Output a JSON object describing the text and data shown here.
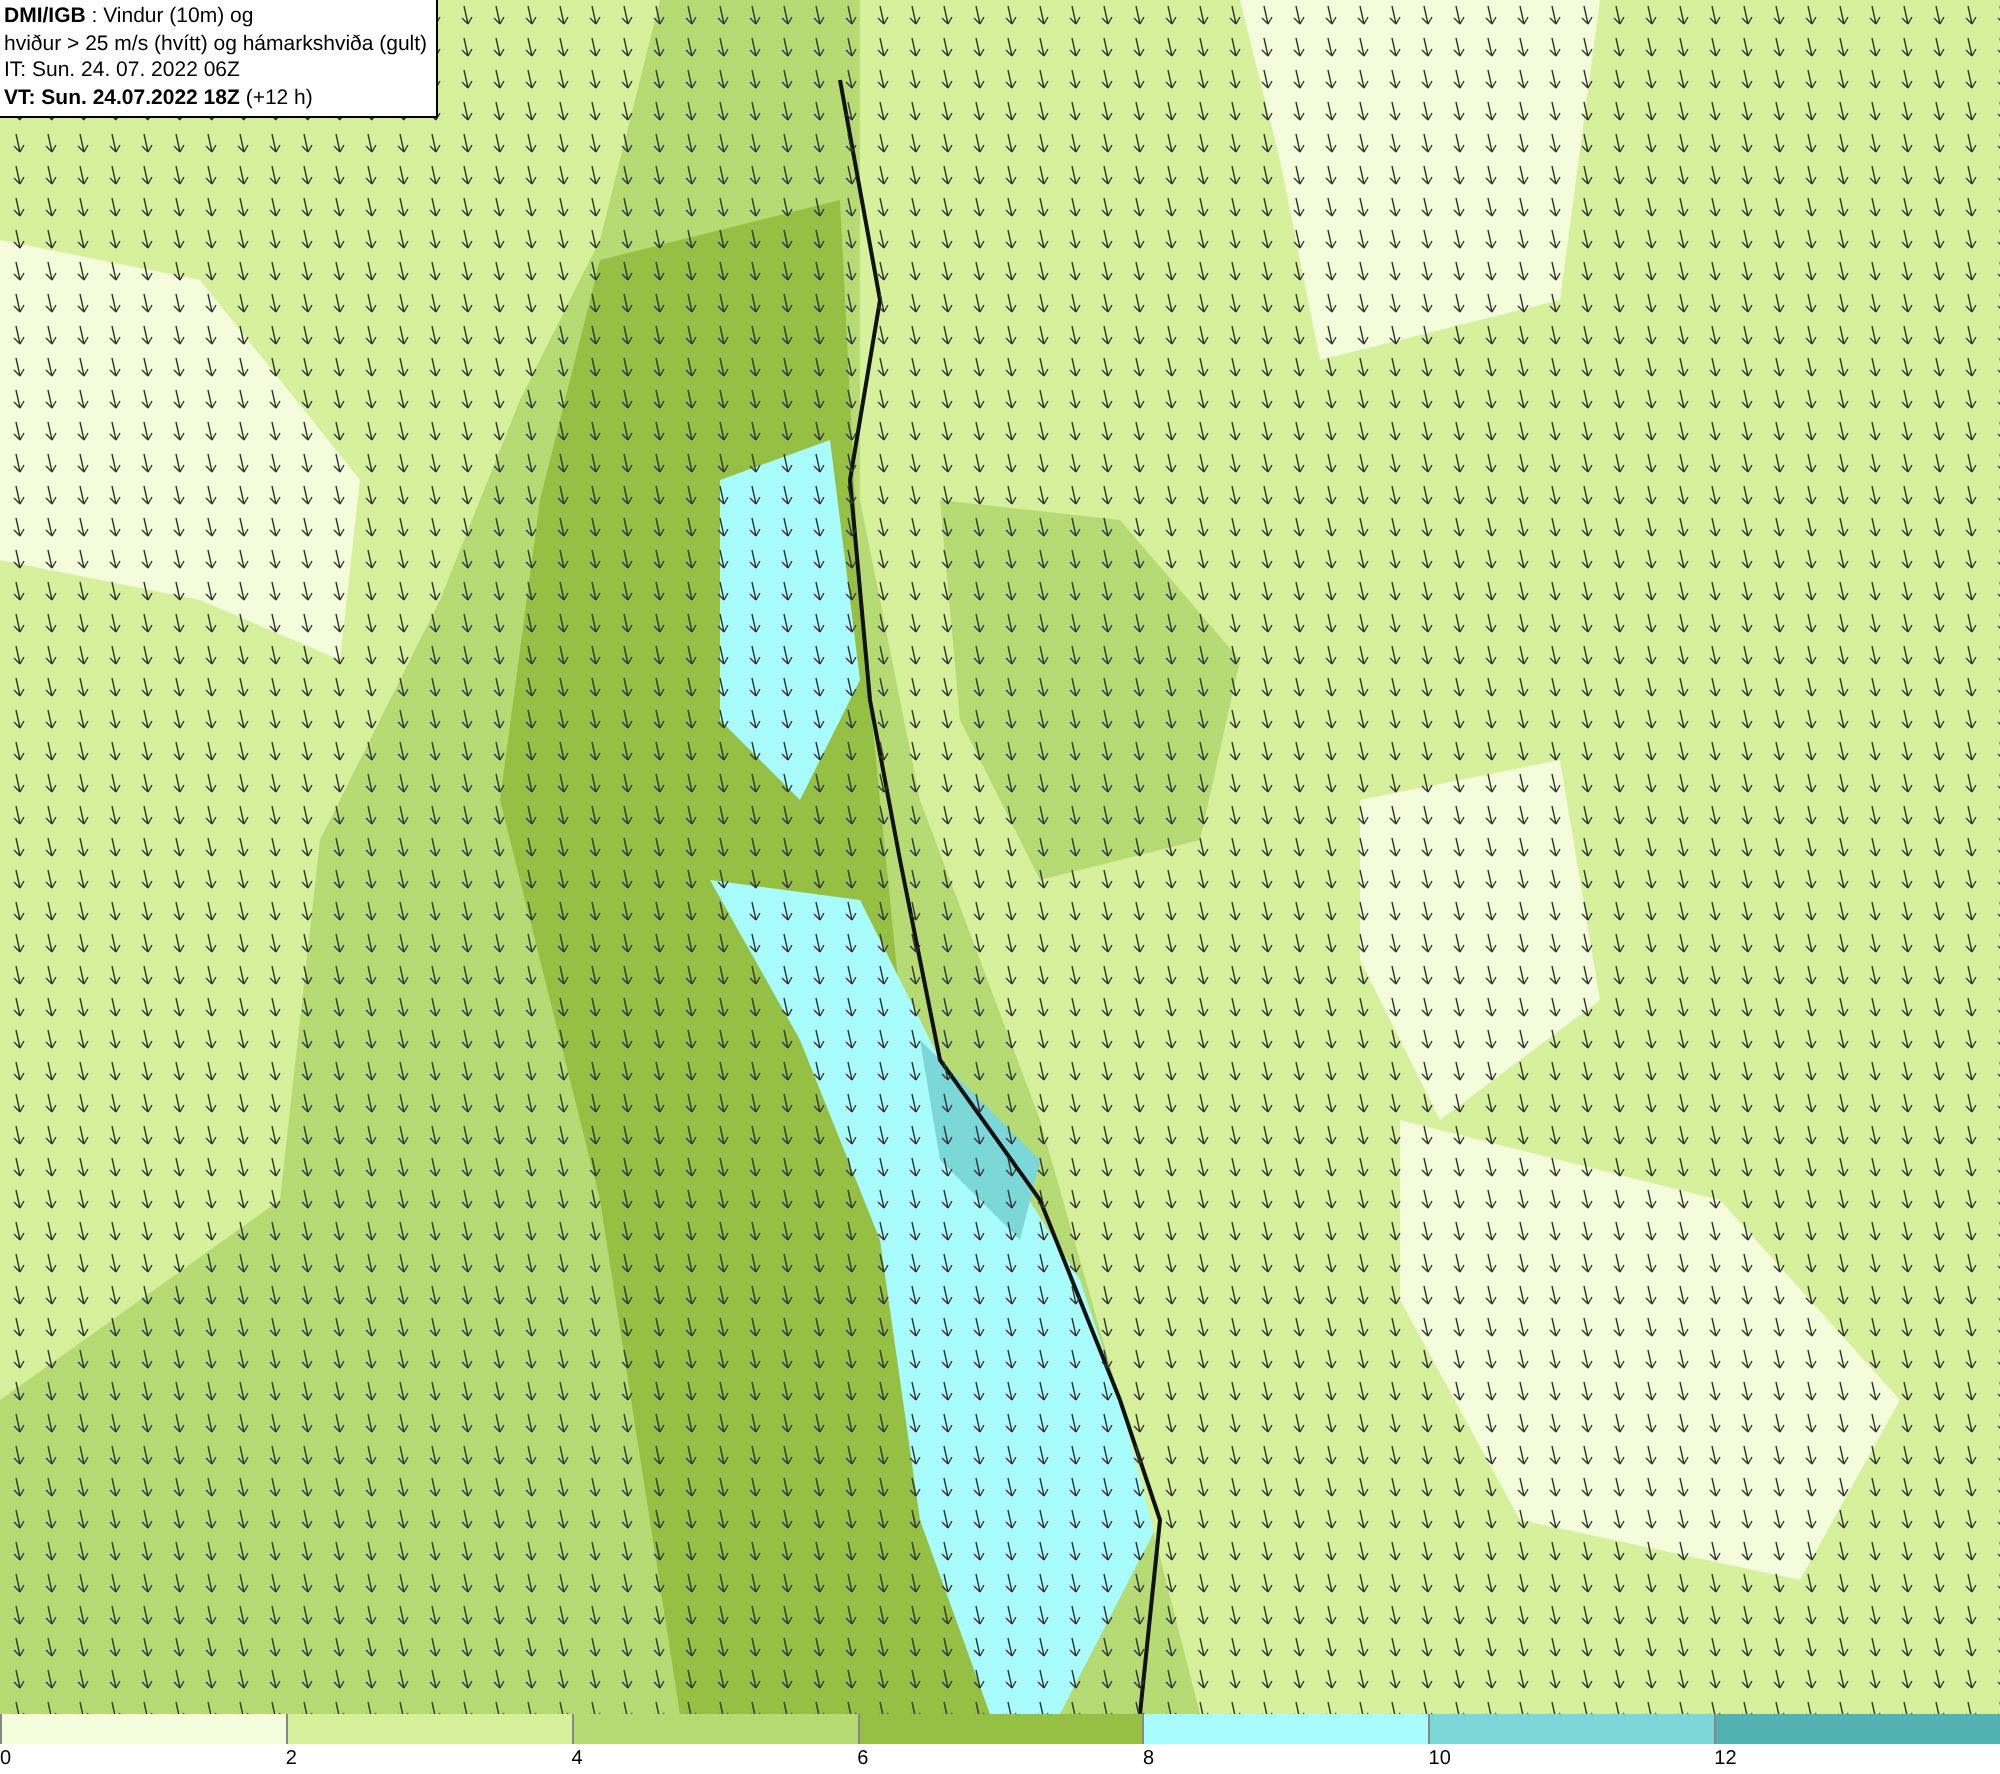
{
  "title_box": {
    "lines": [
      "**DMI/IGB** : Vindur (10m) og",
      "hviður > 25 m/s (hvítt) og hámarkshviða (gult)",
      "IT: Sun. 24. 07. 2022 06Z",
      "**VT: Sun. 24.07.2022 18Z** (+12 h)"
    ]
  },
  "legend": {
    "segments": [
      {
        "color": "#f4fcdc"
      },
      {
        "color": "#d6f09c"
      },
      {
        "color": "#b6da74"
      },
      {
        "color": "#96c044"
      },
      {
        "color": "#a8fcfc"
      },
      {
        "color": "#7cd8d8"
      },
      {
        "color": "#52b2b2"
      }
    ],
    "labels": [
      "0",
      "2",
      "4",
      "6",
      "8",
      "10",
      "12"
    ]
  }
}
